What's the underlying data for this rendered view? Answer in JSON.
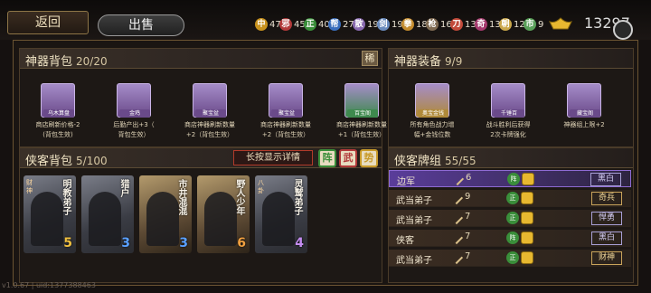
{
  "topbar": {
    "back_label": "返回",
    "sell_label": "出售",
    "resources": [
      {
        "icon": "中",
        "value": "47",
        "color": "#c8921e"
      },
      {
        "icon": "邪",
        "value": "45",
        "color": "#b23a3a"
      },
      {
        "icon": "正",
        "value": "40",
        "color": "#3a8e3a"
      },
      {
        "icon": "帮",
        "value": "27",
        "color": "#3a6ebd"
      },
      {
        "icon": "散",
        "value": "19",
        "color": "#8a6ab0"
      },
      {
        "icon": "剑",
        "value": "19",
        "color": "#6a8bbd"
      },
      {
        "icon": "拳",
        "value": "18",
        "color": "#c48b2d"
      },
      {
        "icon": "枪",
        "value": "16",
        "color": "#7f6a52"
      },
      {
        "icon": "刀",
        "value": "13",
        "color": "#c24a3a"
      },
      {
        "icon": "奇",
        "value": "13",
        "color": "#a53a6e"
      },
      {
        "icon": "朝",
        "value": "12",
        "color": "#c9a64a"
      },
      {
        "icon": "市",
        "value": "9",
        "color": "#5aa05a"
      }
    ],
    "gold": "13297",
    "icons": [
      "gold-ingot-icon",
      "settings-icon"
    ]
  },
  "artifact_bag": {
    "title": "神器背包",
    "count": "20/20",
    "rare_label": "稀",
    "items": [
      {
        "tag": "乌木算盘",
        "desc1": "商店刷新价格-2",
        "desc2": "(背包生效)",
        "color": "#6a4a8a"
      },
      {
        "tag": "金鸡",
        "desc1": "后勤产出+3（",
        "desc2": "背包生效）",
        "color": "#6a4a8a"
      },
      {
        "tag": "聚宝盆",
        "desc1": "商店神器刷新数量",
        "desc2": "+2（背包生效）",
        "color": "#6a4a8a"
      },
      {
        "tag": "聚宝盆",
        "desc1": "商店神器刷新数量",
        "desc2": "+2（背包生效）",
        "color": "#6a4a8a"
      },
      {
        "tag": "百宝阁",
        "desc1": "商店神器刷新数量",
        "desc2": "+1（背包生效）",
        "color": "#3e8a4e"
      }
    ]
  },
  "artifact_equip": {
    "title": "神器装备",
    "count": "9/9",
    "items": [
      {
        "tag": "奥宝金钱",
        "desc1": "所有角色战力增",
        "desc2": "幅+金钱位数",
        "color": "#b08a3a"
      },
      {
        "tag": "千锤百",
        "desc1": "战斗胜利后获得",
        "desc2": "2次卡牌强化",
        "color": "#6a4a8a"
      },
      {
        "tag": "藏宝阁",
        "desc1": "神器组上限+2",
        "desc2": "",
        "color": "#6a4a8a"
      }
    ]
  },
  "hero_bag": {
    "title": "侠客背包",
    "count": "5/100",
    "detail_button": "长按显示详情",
    "filters": [
      "阵",
      "武",
      "势"
    ],
    "cards": [
      {
        "name": "明教弟子",
        "sub": "财神",
        "num": "5",
        "num_color": "#f0c040",
        "style": "gray"
      },
      {
        "name": "猎户",
        "sub": "",
        "num": "3",
        "num_color": "#5aa0ff",
        "style": "gray"
      },
      {
        "name": "市井混混",
        "sub": "",
        "num": "3",
        "num_color": "#5aa0ff",
        "style": "gold"
      },
      {
        "name": "野人少年",
        "sub": "",
        "num": "6",
        "num_color": "#f0a040",
        "style": "gold"
      },
      {
        "name": "灵鹫弟子",
        "sub": "八卦",
        "num": "4",
        "num_color": "#c48cf0",
        "style": "gray"
      }
    ]
  },
  "hero_deck": {
    "title": "侠客牌组",
    "count": "55/55",
    "rows": [
      {
        "name": "边军",
        "power": "6",
        "badge": "阵",
        "badge_color": "#3a8e3a",
        "tag": "黑白",
        "tag_style": "p",
        "selected": true
      },
      {
        "name": "武当弟子",
        "power": "9",
        "badge": "正",
        "badge_color": "#3a8e3a",
        "tag": "奇兵",
        "tag_style": "g",
        "selected": false
      },
      {
        "name": "武当弟子",
        "power": "7",
        "badge": "正",
        "badge_color": "#3a8e3a",
        "tag": "悍勇",
        "tag_style": "p",
        "selected": false
      },
      {
        "name": "侠客",
        "power": "7",
        "badge": "阵",
        "badge_color": "#3a8e3a",
        "tag": "黑白",
        "tag_style": "p",
        "selected": false
      },
      {
        "name": "武当弟子",
        "power": "7",
        "badge": "正",
        "badge_color": "#3a8e3a",
        "tag": "财神",
        "tag_style": "g",
        "selected": false
      }
    ]
  },
  "footer": {
    "version": "v1.0.67 | uid:1377388463"
  }
}
